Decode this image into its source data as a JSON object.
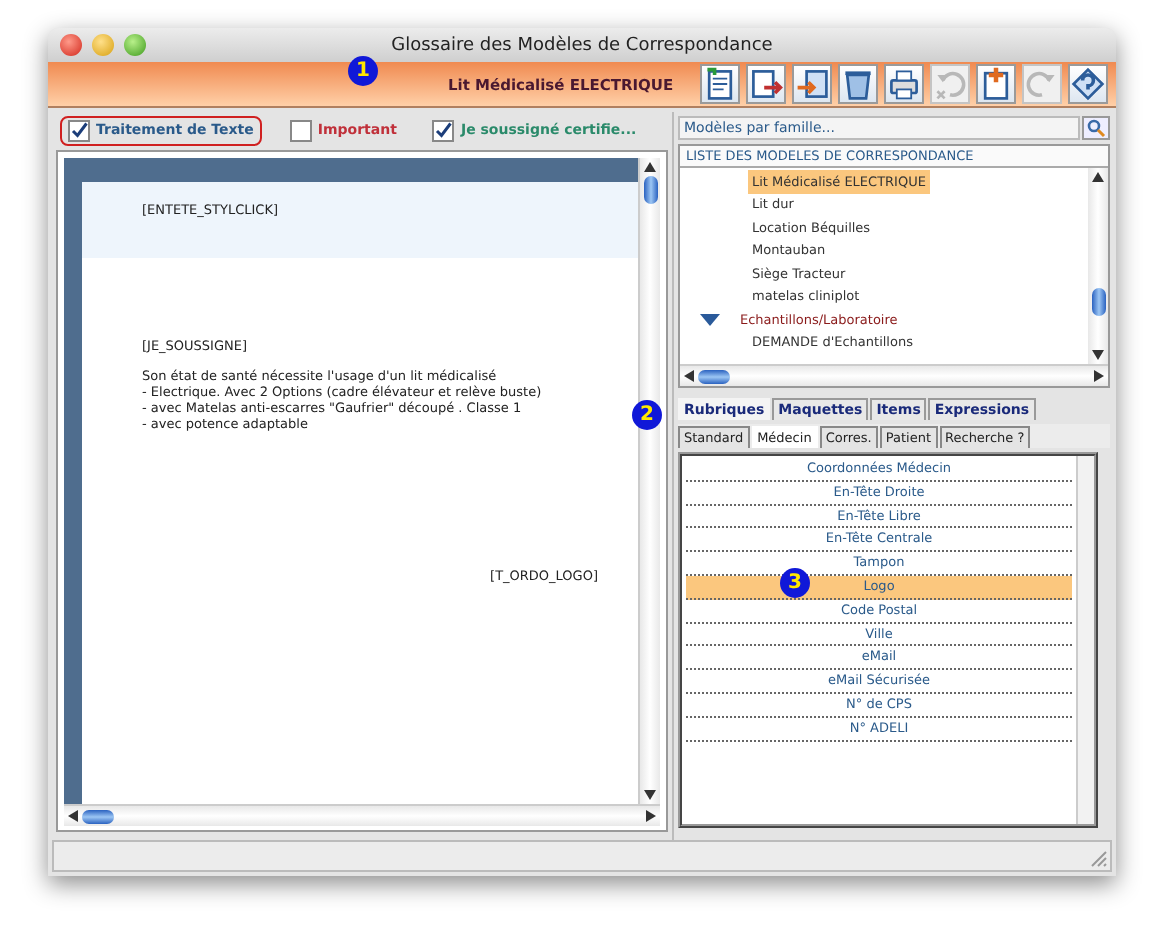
{
  "window": {
    "title": "Glossaire des Modèles de Correspondance"
  },
  "toolbar": {
    "title": "Lit Médicalisé ELECTRIQUE",
    "buttons": [
      {
        "kind": "document",
        "disabled": false
      },
      {
        "kind": "export",
        "disabled": false
      },
      {
        "kind": "import",
        "disabled": false
      },
      {
        "kind": "trash",
        "disabled": false
      },
      {
        "kind": "printer",
        "disabled": false
      },
      {
        "kind": "undo",
        "disabled": true
      },
      {
        "kind": "add",
        "disabled": false
      },
      {
        "kind": "redo",
        "disabled": true
      },
      {
        "kind": "help",
        "disabled": false
      }
    ]
  },
  "options": [
    {
      "label": "Traitement de Texte",
      "checked": true,
      "highlighted": true,
      "color": "#2a5a8a"
    },
    {
      "label": "Important",
      "checked": false,
      "highlighted": false,
      "color": "#c0303a"
    },
    {
      "label": "Je soussigné certifie...",
      "checked": true,
      "highlighted": false,
      "color": "#2a8a6a"
    }
  ],
  "document": {
    "header_lines": [
      "[ENTETE_STYLCLICK]"
    ],
    "body_lines": [
      "[JE_SOUSSIGNE]",
      "Son état de santé nécessite l'usage d'un lit médicalisé",
      "- Electrique. Avec 2 Options (cadre élévateur et relève buste)",
      "- avec Matelas anti-escarres \"Gaufrier\" découpé . Classe 1",
      "- avec potence adaptable"
    ],
    "footer": "[T_ORDO_LOGO]"
  },
  "search": {
    "placeholder": "Modèles par famille..."
  },
  "models": {
    "header": "LISTE DES MODELES DE CORRESPONDANCE",
    "items": [
      {
        "label": "Lit Médicalisé ELECTRIQUE",
        "selected": true
      },
      {
        "label": "Lit dur",
        "selected": false
      },
      {
        "label": "Location Béquilles",
        "selected": false
      },
      {
        "label": "Montauban",
        "selected": false
      },
      {
        "label": "Siège Tracteur",
        "selected": false
      },
      {
        "label": "matelas cliniplot",
        "selected": false
      },
      {
        "label": "Echantillons/Laboratoire",
        "selected": false,
        "expanded": true,
        "children": [
          {
            "label": "DEMANDE d'Echantillons",
            "selected": false
          }
        ]
      }
    ]
  },
  "tabs": [
    {
      "label": "Rubriques",
      "selected": true
    },
    {
      "label": "Maquettes",
      "selected": false
    },
    {
      "label": "Items",
      "selected": false
    },
    {
      "label": "Expressions",
      "selected": false
    }
  ],
  "subtabs": [
    {
      "label": "Standard",
      "selected": false
    },
    {
      "label": "Médecin",
      "selected": true
    },
    {
      "label": "Corres.",
      "selected": false
    },
    {
      "label": "Patient",
      "selected": false
    },
    {
      "label": "Recherche ?",
      "selected": false
    }
  ],
  "fields": [
    {
      "label": "Coordonnées Médecin",
      "selected": false
    },
    {
      "label": "En-Tête Droite",
      "selected": false
    },
    {
      "label": "En-Tête Libre",
      "selected": false
    },
    {
      "label": "En-Tête Centrale",
      "selected": false
    },
    {
      "label": "Tampon",
      "selected": false
    },
    {
      "label": "Logo",
      "selected": true
    },
    {
      "label": "Code Postal",
      "selected": false
    },
    {
      "label": "Ville",
      "selected": false
    },
    {
      "label": "eMail",
      "selected": false
    },
    {
      "label": "eMail Sécurisée",
      "selected": false
    },
    {
      "label": "N° de CPS",
      "selected": false
    },
    {
      "label": "N° ADELI",
      "selected": false
    }
  ],
  "callouts": [
    "1",
    "2",
    "3"
  ]
}
